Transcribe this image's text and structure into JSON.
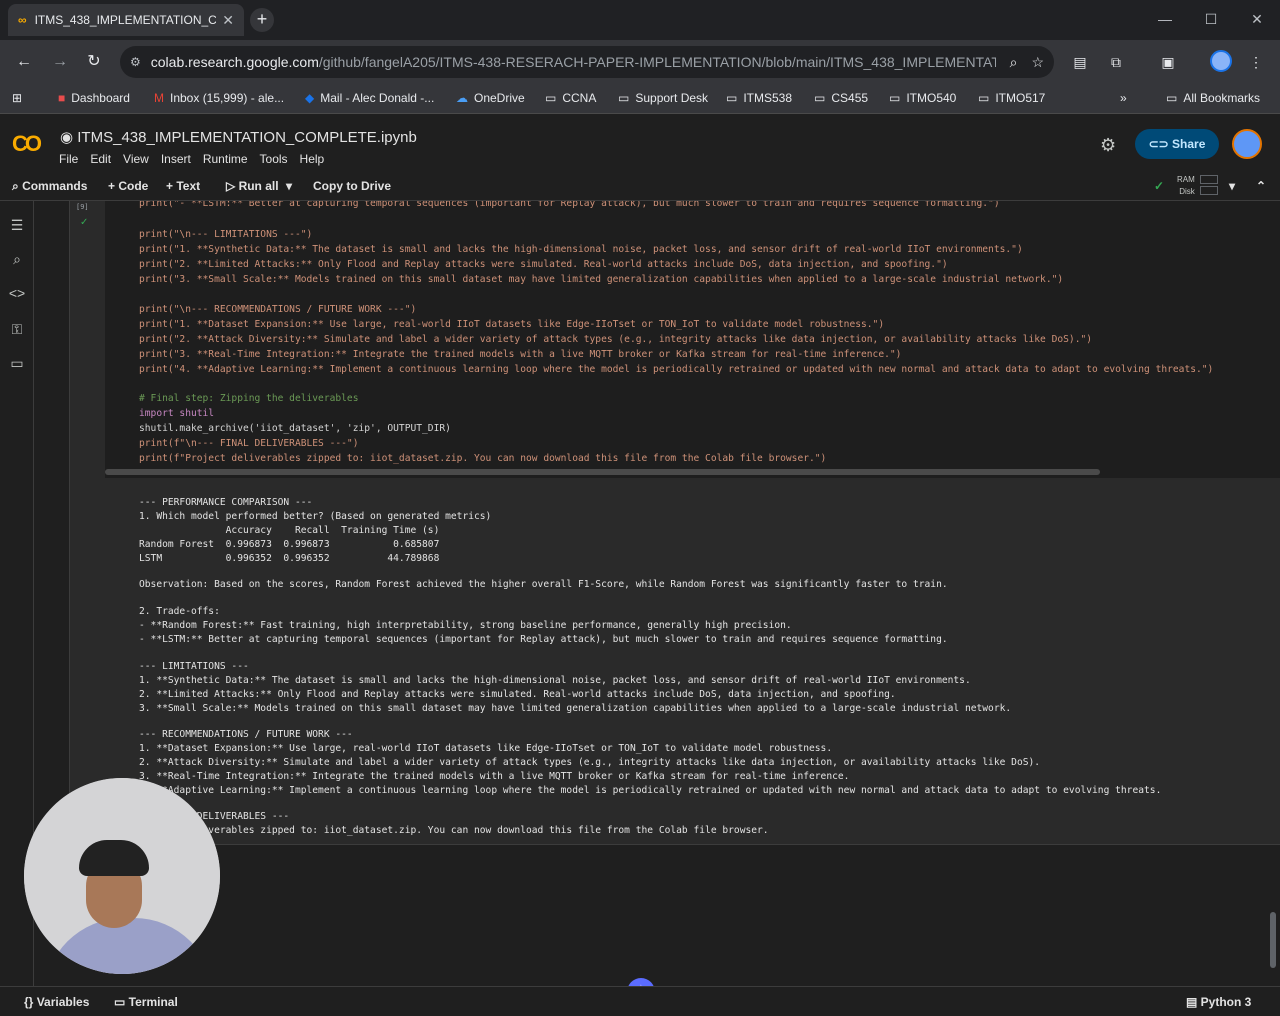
{
  "browser": {
    "tab_title": "ITMS_438_IMPLEMENTATION_C",
    "tab_close": "✕",
    "new_tab": "+",
    "url_host": "colab.research.google.com",
    "url_path": "/github/fangelA205/ITMS-438-RESERACH-PAPER-IMPLEMENTATION/blob/main/ITMS_438_IMPLEMENTATI..."
  },
  "bookmarks": [
    "Dashboard",
    "Inbox (15,999) - ale...",
    "Mail - Alec Donald -...",
    "OneDrive",
    "CCNA",
    "Support Desk",
    "ITMS538",
    "CS455",
    "ITMO540",
    "ITMO517"
  ],
  "bookmarks_overflow": "»",
  "all_bookmarks": "All Bookmarks",
  "colab": {
    "logo": "CO",
    "notebook_title": "ITMS_438_IMPLEMENTATION_COMPLETE.ipynb",
    "menu": [
      "File",
      "Edit",
      "View",
      "Insert",
      "Runtime",
      "Tools",
      "Help"
    ],
    "share": "Share"
  },
  "toolbar": {
    "commands": "Commands",
    "code": "+ Code",
    "text": "+ Text",
    "run_all": "▷ Run all",
    "copy_to_drive": "Copy to Drive",
    "ram": "RAM",
    "disk": "Disk"
  },
  "cell": {
    "exec_count": "[9]",
    "code_lines": [
      "print(\"- **LSTM:** Better at capturing temporal sequences (important for Replay attack), but much slower to train and requires sequence formatting.\")",
      "",
      "print(\"\\n--- LIMITATIONS ---\")",
      "print(\"1. **Synthetic Data:** The dataset is small and lacks the high-dimensional noise, packet loss, and sensor drift of real-world IIoT environments.\")",
      "print(\"2. **Limited Attacks:** Only Flood and Replay attacks were simulated. Real-world attacks include DoS, data injection, and spoofing.\")",
      "print(\"3. **Small Scale:** Models trained on this small dataset may have limited generalization capabilities when applied to a large-scale industrial network.\")",
      "",
      "print(\"\\n--- RECOMMENDATIONS / FUTURE WORK ---\")",
      "print(\"1. **Dataset Expansion:** Use large, real-world IIoT datasets like Edge-IIoTset or TON_IoT to validate model robustness.\")",
      "print(\"2. **Attack Diversity:** Simulate and label a wider variety of attack types (e.g., integrity attacks like data injection, or availability attacks like DoS).\")",
      "print(\"3. **Real-Time Integration:** Integrate the trained models with a live MQTT broker or Kafka stream for real-time inference.\")",
      "print(\"4. **Adaptive Learning:** Implement a continuous learning loop where the model is periodically retrained or updated with new normal and attack data to adapt to evolving threats.\")",
      "",
      "# Final step: Zipping the deliverables",
      "import shutil",
      "shutil.make_archive('iiot_dataset', 'zip', OUTPUT_DIR)",
      "print(f\"\\n--- FINAL DELIVERABLES ---\")",
      "print(f\"Project deliverables zipped to: iiot_dataset.zip. You can now download this file from the Colab file browser.\")"
    ],
    "output_lines": [
      "--- PERFORMANCE COMPARISON ---",
      "1. Which model performed better? (Based on generated metrics)",
      "               Accuracy    Recall  Training Time (s)",
      "Random Forest  0.996873  0.996873           0.685807",
      "LSTM           0.996352  0.996352          44.789868",
      "",
      "Observation: Based on the scores, Random Forest achieved the higher overall F1-Score, while Random Forest was significantly faster to train.",
      "",
      "2. Trade-offs:",
      "- **Random Forest:** Fast training, high interpretability, strong baseline performance, generally high precision.",
      "- **LSTM:** Better at capturing temporal sequences (important for Replay attack), but much slower to train and requires sequence formatting.",
      "",
      "--- LIMITATIONS ---",
      "1. **Synthetic Data:** The dataset is small and lacks the high-dimensional noise, packet loss, and sensor drift of real-world IIoT environments.",
      "2. **Limited Attacks:** Only Flood and Replay attacks were simulated. Real-world attacks include DoS, data injection, and spoofing.",
      "3. **Small Scale:** Models trained on this small dataset may have limited generalization capabilities when applied to a large-scale industrial network.",
      "",
      "--- RECOMMENDATIONS / FUTURE WORK ---",
      "1. **Dataset Expansion:** Use large, real-world IIoT datasets like Edge-IIoTset or TON_IoT to validate model robustness.",
      "2. **Attack Diversity:** Simulate and label a wider variety of attack types (e.g., integrity attacks like data injection, or availability attacks like DoS).",
      "3. **Real-Time Integration:** Integrate the trained models with a live MQTT broker or Kafka stream for real-time inference.",
      "4. **Adaptive Learning:** Implement a continuous learning loop where the model is periodically retrained or updated with new normal and attack data to adapt to evolving threats.",
      "",
      "--- FINAL DELIVERABLES ---",
      "Project deliverables zipped to: iiot_dataset.zip. You can now download this file from the Colab file browser."
    ]
  },
  "statusbar": {
    "variables": "Variables",
    "terminal": "Terminal",
    "kernel": "Python 3"
  }
}
